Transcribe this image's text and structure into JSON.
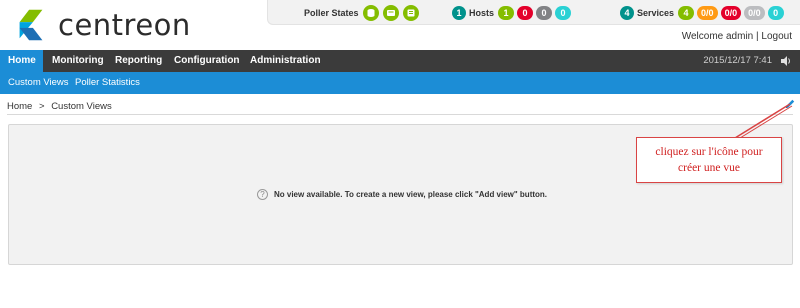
{
  "brand": {
    "name": "centreon"
  },
  "header": {
    "poller_states_label": "Poller States",
    "hosts": {
      "label": "Hosts",
      "total": "1",
      "up": "1",
      "down": "0",
      "unreachable": "0",
      "pending": "0"
    },
    "services": {
      "label": "Services",
      "total": "4",
      "ok": "4",
      "warning": "0/0",
      "critical": "0/0",
      "unknown": "0/0",
      "pending": "0"
    },
    "welcome_text": "Welcome admin",
    "separator": "|",
    "logout_label": "Logout"
  },
  "nav": {
    "items": [
      {
        "label": "Home"
      },
      {
        "label": "Monitoring"
      },
      {
        "label": "Reporting"
      },
      {
        "label": "Configuration"
      },
      {
        "label": "Administration"
      }
    ],
    "datetime": "2015/12/17 7:41"
  },
  "subnav": {
    "items": [
      {
        "label": "Custom Views"
      },
      {
        "label": "Poller Statistics"
      }
    ]
  },
  "breadcrumb": {
    "home": "Home",
    "separator": ">",
    "current": "Custom Views"
  },
  "main": {
    "empty_message": "No view available. To create a new view, please click \"Add view\" button."
  },
  "annotation": {
    "line1": "cliquez sur l'icône pour",
    "line2": "créer une vue"
  },
  "colors": {
    "green": "#84bd00",
    "red": "#e4002b",
    "orange": "#ff9a13",
    "grey": "#818285",
    "cyan": "#2ad1d4",
    "teal": "#00928c",
    "blue": "#1c8dd6",
    "dark": "#3b3b3b"
  }
}
